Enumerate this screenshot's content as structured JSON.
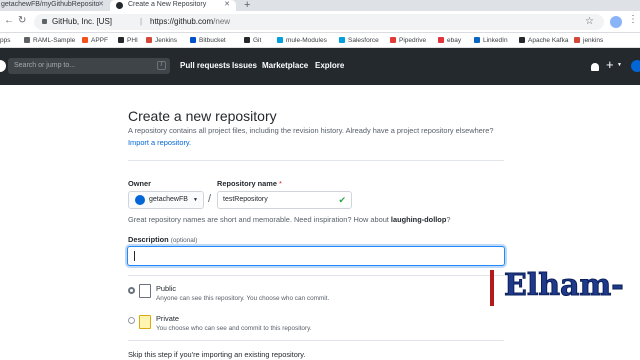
{
  "browser": {
    "tabs": [
      {
        "label": "getachewFB/myGithubReposito"
      },
      {
        "label": "Create a New Repository"
      }
    ],
    "omnibox": {
      "site": "GitHub, Inc. [US]",
      "separator": "|",
      "url_host": "https://github.com",
      "url_path": "/new"
    },
    "bookmarks": [
      {
        "label": "pps",
        "color": "#5f6368"
      },
      {
        "label": "RAML-Sample",
        "color": "#5f6368"
      },
      {
        "label": "APPF",
        "color": "#f4511e"
      },
      {
        "label": "PHI",
        "color": "#24292e"
      },
      {
        "label": "Jenkins",
        "color": "#d24939"
      },
      {
        "label": "Bitbucket",
        "color": "#0052cc"
      },
      {
        "label": "Git",
        "color": "#24292e"
      },
      {
        "label": "mule-Modules",
        "color": "#00a0df"
      },
      {
        "label": "Salesforce",
        "color": "#00a1e0"
      },
      {
        "label": "Pipedrive",
        "color": "#e53935"
      },
      {
        "label": "ebay",
        "color": "#e53238"
      },
      {
        "label": "LinkedIn",
        "color": "#0a66c2"
      },
      {
        "label": "Apache Kafka",
        "color": "#24292e"
      },
      {
        "label": "jenkins",
        "color": "#d24939"
      }
    ]
  },
  "github_header": {
    "search_placeholder": "Search or jump to...",
    "search_shortcut": "/",
    "nav": [
      "Pull requests",
      "Issues",
      "Marketplace",
      "Explore"
    ]
  },
  "page": {
    "title": "Create a new repository",
    "subtitle": "A repository contains all project files, including the revision history. Already have a project repository elsewhere?",
    "import_link": "Import a repository.",
    "owner_label": "Owner",
    "owner_value": "getachewFB",
    "slash": "/",
    "repo_label": "Repository name",
    "required_mark": "*",
    "repo_value": "testRepository",
    "hint_prefix": "Great repository names are short and memorable. Need inspiration? How about ",
    "hint_suggestion": "laughing-dollop",
    "hint_suffix": "?",
    "description_label": "Description",
    "description_optional": "(optional)",
    "description_value": "",
    "visibility": [
      {
        "title": "Public",
        "desc": "Anyone can see this repository. You choose who can commit.",
        "selected": true
      },
      {
        "title": "Private",
        "desc": "You choose who can see and commit to this repository.",
        "selected": false
      }
    ],
    "skip_text": "Skip this step if you're importing an existing repository."
  },
  "watermark": {
    "text": "Elham-",
    "color": "#1f3a8a"
  }
}
